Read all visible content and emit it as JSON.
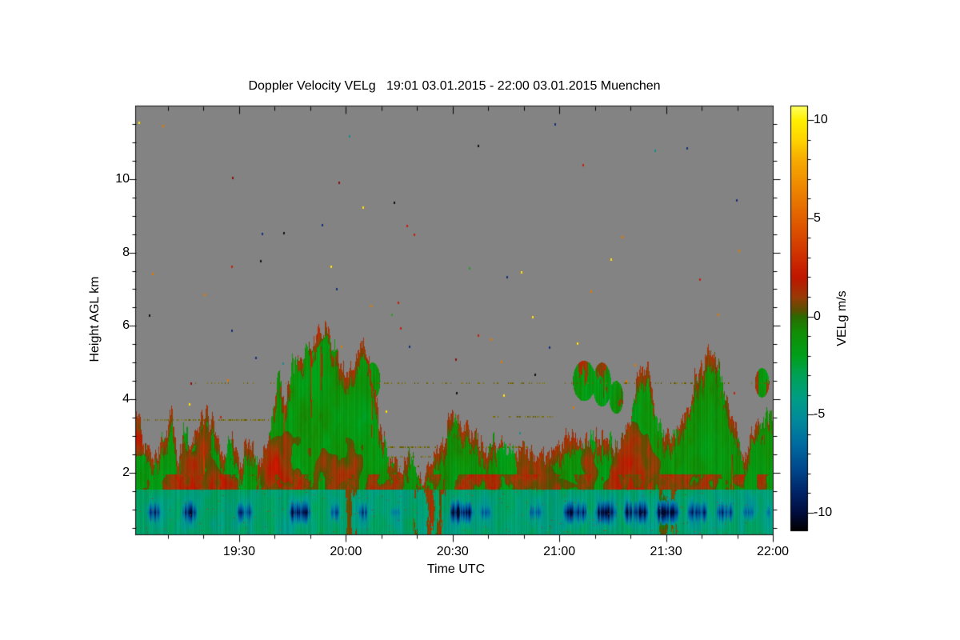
{
  "title": {
    "text": "Doppler Velocity VELg   19:01 03.01.2015 - 22:00 03.01.2015 Muenchen"
  },
  "chart_data": {
    "type": "heatmap",
    "title": "Doppler Velocity VELg   19:01 03.01.2015 - 22:00 03.01.2015 Muenchen",
    "quantity": "Doppler Velocity VELg",
    "time_start": "19:01 03.01.2015",
    "time_end": "22:00 03.01.2015",
    "station": "Muenchen",
    "xlabel": "Time UTC",
    "ylabel": "Height AGL km",
    "x_axis": {
      "range_minutes": [
        0,
        179
      ],
      "start_time": "19:01",
      "major_ticks": [
        {
          "t": 29,
          "label": "19:30"
        },
        {
          "t": 59,
          "label": "20:00"
        },
        {
          "t": 89,
          "label": "20:30"
        },
        {
          "t": 119,
          "label": "21:00"
        },
        {
          "t": 149,
          "label": "21:30"
        },
        {
          "t": 179,
          "label": "22:00"
        }
      ],
      "minor_step_minutes": 10
    },
    "y_axis": {
      "range_km": [
        0.32,
        11.98
      ],
      "major_ticks": [
        2,
        4,
        6,
        8,
        10
      ],
      "minor_step_km": 0.5
    },
    "colorbar": {
      "label": "VELg m/s",
      "range": [
        -10.9,
        10.7
      ],
      "major_ticks": [
        10,
        5,
        0,
        -5,
        -10
      ],
      "minor_step": 1,
      "stops": [
        [
          10.7,
          "#FFFF5C"
        ],
        [
          10.0,
          "#FFF000"
        ],
        [
          9.0,
          "#FFD400"
        ],
        [
          8.0,
          "#F7AC00"
        ],
        [
          6.5,
          "#EE8600"
        ],
        [
          5.0,
          "#E26000"
        ],
        [
          4.0,
          "#D84800"
        ],
        [
          3.0,
          "#CE2E00"
        ],
        [
          2.0,
          "#C01600"
        ],
        [
          1.0,
          "#9A3A06"
        ],
        [
          0.55,
          "#6E4A04"
        ],
        [
          0.25,
          "#565200"
        ],
        [
          0.0,
          "#2C6A02"
        ],
        [
          -0.8,
          "#128E06"
        ],
        [
          -2.0,
          "#00A01A"
        ],
        [
          -3.0,
          "#00A256"
        ],
        [
          -4.2,
          "#009E86"
        ],
        [
          -5.2,
          "#008C9A"
        ],
        [
          -6.5,
          "#006CA0"
        ],
        [
          -7.8,
          "#00488C"
        ],
        [
          -9.0,
          "#002468"
        ],
        [
          -10.0,
          "#000E40"
        ],
        [
          -10.9,
          "#000004"
        ]
      ]
    },
    "background_value_color": "#838383",
    "frame_color": "#000000",
    "field": {
      "seed": 7,
      "envelope_km": [
        [
          0,
          3.6
        ],
        [
          3,
          2.7
        ],
        [
          5,
          2.3
        ],
        [
          8,
          3.1
        ],
        [
          10,
          3.6
        ],
        [
          12,
          2.3
        ],
        [
          14,
          3.3
        ],
        [
          16,
          2.7
        ],
        [
          19,
          3.7
        ],
        [
          22,
          3.4
        ],
        [
          24,
          2.3
        ],
        [
          27,
          3.0
        ],
        [
          29,
          2.2
        ],
        [
          32,
          2.9
        ],
        [
          35,
          2.1
        ],
        [
          38,
          3.3
        ],
        [
          40,
          4.7
        ],
        [
          42,
          3.8
        ],
        [
          44,
          5.0
        ],
        [
          47,
          5.3
        ],
        [
          50,
          5.6
        ],
        [
          53,
          5.9
        ],
        [
          55,
          5.6
        ],
        [
          57,
          5.1
        ],
        [
          59,
          4.5
        ],
        [
          61,
          4.9
        ],
        [
          63,
          5.5
        ],
        [
          65,
          5.2
        ],
        [
          67,
          4.3
        ],
        [
          69,
          3.0
        ],
        [
          71,
          2.5
        ],
        [
          74,
          2.0
        ],
        [
          77,
          2.4
        ],
        [
          80,
          1.8
        ],
        [
          83,
          2.3
        ],
        [
          86,
          2.7
        ],
        [
          89,
          3.6
        ],
        [
          92,
          3.3
        ],
        [
          95,
          3.0
        ],
        [
          98,
          2.6
        ],
        [
          101,
          2.9
        ],
        [
          104,
          2.7
        ],
        [
          107,
          2.5
        ],
        [
          110,
          2.7
        ],
        [
          113,
          2.3
        ],
        [
          116,
          2.6
        ],
        [
          119,
          2.9
        ],
        [
          122,
          3.1
        ],
        [
          125,
          2.7
        ],
        [
          128,
          2.8
        ],
        [
          131,
          3.0
        ],
        [
          134,
          2.7
        ],
        [
          137,
          2.9
        ],
        [
          139,
          3.5
        ],
        [
          141,
          4.7
        ],
        [
          143,
          5.1
        ],
        [
          145,
          4.3
        ],
        [
          147,
          3.3
        ],
        [
          149,
          2.9
        ],
        [
          152,
          3.2
        ],
        [
          155,
          3.6
        ],
        [
          157,
          4.5
        ],
        [
          159,
          4.9
        ],
        [
          161,
          5.3
        ],
        [
          163,
          5.0
        ],
        [
          165,
          4.5
        ],
        [
          167,
          3.7
        ],
        [
          169,
          3.1
        ],
        [
          171,
          2.3
        ],
        [
          173,
          3.1
        ],
        [
          175,
          3.4
        ],
        [
          177,
          3.6
        ],
        [
          179,
          3.5
        ]
      ],
      "blobs": [
        [
          126,
          4.5,
          3.2,
          0.55
        ],
        [
          131,
          4.4,
          2.6,
          0.6
        ],
        [
          135,
          4.05,
          2.0,
          0.45
        ],
        [
          66.5,
          4.5,
          2.2,
          0.5
        ],
        [
          176,
          4.45,
          2.0,
          0.4
        ]
      ],
      "teal_band": {
        "h": [
          0.3,
          1.55
        ],
        "value": -3.6
      },
      "navy_band_h": [
        0.45,
        1.45
      ],
      "navy_clusters": [
        [
          3,
          7,
          0.8
        ],
        [
          13,
          17,
          0.9
        ],
        [
          28,
          33,
          0.7
        ],
        [
          43,
          49,
          0.85
        ],
        [
          54,
          58,
          0.6
        ],
        [
          62,
          66,
          0.6
        ],
        [
          71,
          75,
          0.5
        ],
        [
          88,
          95,
          0.85
        ],
        [
          96,
          100,
          0.6
        ],
        [
          110,
          115,
          0.55
        ],
        [
          120,
          127,
          0.8
        ],
        [
          129,
          135,
          0.9
        ],
        [
          137,
          144,
          0.85
        ],
        [
          146,
          153,
          0.9
        ],
        [
          155,
          161,
          0.8
        ],
        [
          163,
          168,
          0.7
        ],
        [
          170,
          174,
          0.6
        ],
        [
          176,
          179,
          0.5
        ]
      ],
      "warm_columns": [
        [
          78,
          87,
          0.55
        ],
        [
          147,
          152,
          0.45
        ],
        [
          59,
          62,
          0.4
        ]
      ],
      "artifact_lines": [
        [
          4.47,
          16,
          178,
          0.3
        ],
        [
          3.45,
          0,
          38,
          0.45
        ],
        [
          3.55,
          100,
          117,
          0.35
        ],
        [
          2.72,
          58,
          110,
          0.5
        ],
        [
          2.45,
          60,
          100,
          0.35
        ],
        [
          2.2,
          62,
          96,
          0.3
        ],
        [
          1.98,
          64,
          84,
          0.25
        ]
      ],
      "artifact_color": "#6E6400",
      "speckles": {
        "count": 62,
        "seed": 2015,
        "palette": [
          "#C82010",
          "#FFE000",
          "#E07800",
          "#121212",
          "#14307A",
          "#8C1010",
          "#1A8C8C",
          "#2E9A2E"
        ],
        "weights": [
          0.24,
          0.2,
          0.14,
          0.12,
          0.1,
          0.08,
          0.06,
          0.06
        ],
        "explicit": [
          [
            0.7,
            11.55,
            "#FFE000"
          ]
        ]
      }
    }
  }
}
